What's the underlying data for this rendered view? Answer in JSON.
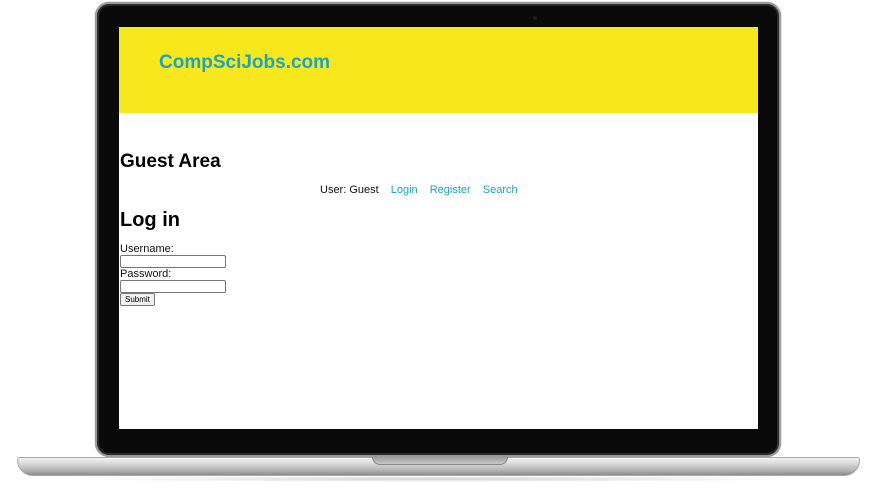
{
  "site": {
    "logo": "CompSciJobs.com",
    "colors": {
      "header_bg": "#f7e71d",
      "link": "#1ba4c4"
    }
  },
  "main": {
    "area_title": "Guest Area",
    "user_label": "User: Guest",
    "nav": {
      "login": "Login",
      "register": "Register",
      "search": "Search"
    },
    "login": {
      "title": "Log in",
      "username_label": "Username:",
      "username_value": "",
      "password_label": "Password:",
      "password_value": "",
      "submit_label": "Submit"
    }
  }
}
